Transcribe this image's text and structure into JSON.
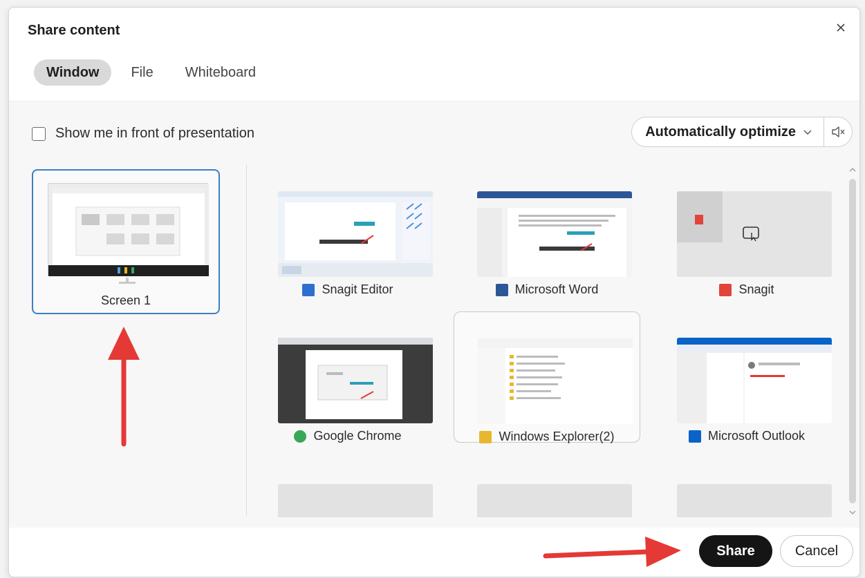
{
  "dialog": {
    "title": "Share content",
    "close_label": "×"
  },
  "tabs": [
    {
      "label": "Window",
      "active": true
    },
    {
      "label": "File",
      "active": false
    },
    {
      "label": "Whiteboard",
      "active": false
    }
  ],
  "options": {
    "show_me_label": "Show me in front of presentation",
    "show_me_checked": false,
    "optimize_label": "Automatically optimize"
  },
  "screens": [
    {
      "label": "Screen 1",
      "selected": true
    }
  ],
  "windows": [
    {
      "label": "Snagit Editor",
      "icon": "snagit-editor-icon",
      "icon_color": "#2f6fd0"
    },
    {
      "label": "Microsoft Word",
      "icon": "word-icon",
      "icon_color": "#2b5797"
    },
    {
      "label": "Snagit",
      "icon": "snagit-icon",
      "icon_color": "#e0443a"
    },
    {
      "label": "Google Chrome",
      "icon": "chrome-icon",
      "icon_color": "#3aa757"
    },
    {
      "label": "Windows Explorer(2)",
      "icon": "folder-icon",
      "icon_color": "#e8b730",
      "selected": true
    },
    {
      "label": "Microsoft Outlook",
      "icon": "outlook-icon",
      "icon_color": "#0a64c8"
    }
  ],
  "footer": {
    "share_label": "Share",
    "cancel_label": "Cancel"
  },
  "colors": {
    "accent_border": "#3b7fc4",
    "annotation_arrow": "#e53935",
    "share_button_bg": "#151515"
  }
}
